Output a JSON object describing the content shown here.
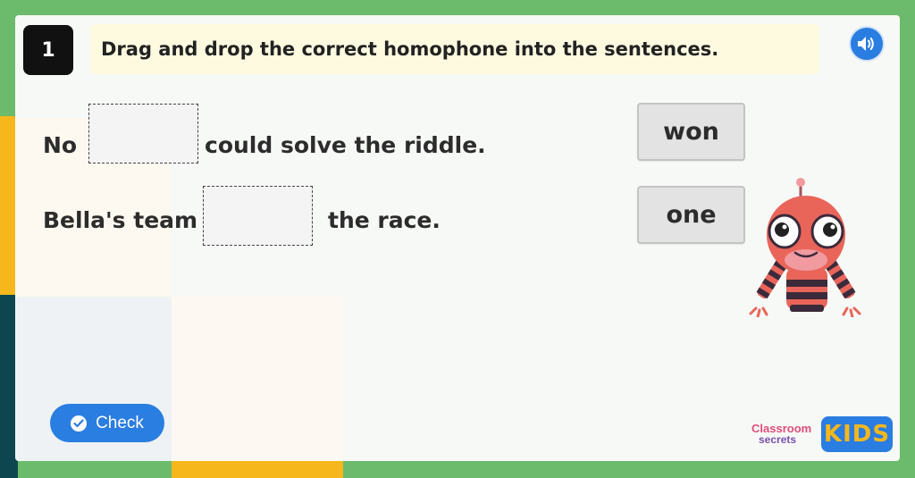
{
  "question": {
    "number": "1",
    "instruction": "Drag and drop the correct homophone into the sentences."
  },
  "audio_button": {
    "icon": "speaker-icon"
  },
  "sentences": [
    {
      "before": "No",
      "after": "could solve the riddle."
    },
    {
      "before": "Bella's team",
      "after": "the race."
    }
  ],
  "word_options": [
    "won",
    "one"
  ],
  "check_button": {
    "label": "Check",
    "icon": "check-circle-icon"
  },
  "brand": {
    "logo_line1": "Classroom",
    "logo_line2": "secrets",
    "logo_kids": "KIDS"
  },
  "colors": {
    "background_green": "#6cbb6c",
    "accent_blue": "#2a7de1",
    "instruction_bg": "#fdfae0",
    "accent_yellow": "#f6b71d"
  }
}
